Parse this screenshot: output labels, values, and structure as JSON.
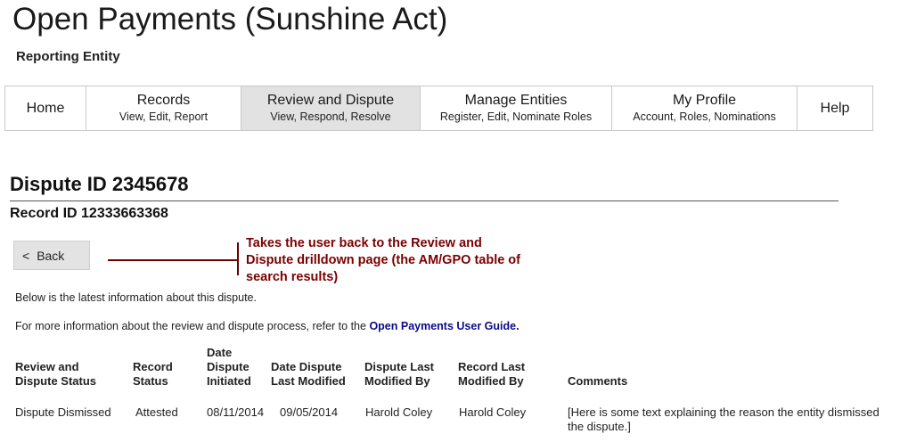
{
  "header": {
    "app_title": "Open Payments (Sunshine Act)",
    "subtitle": "Reporting Entity"
  },
  "nav": {
    "items": [
      {
        "label": "Home",
        "sub": ""
      },
      {
        "label": "Records",
        "sub": "View, Edit, Report"
      },
      {
        "label": "Review and Dispute",
        "sub": "View, Respond, Resolve"
      },
      {
        "label": "Manage Entities",
        "sub": "Register, Edit, Nominate Roles"
      },
      {
        "label": "My Profile",
        "sub": "Account, Roles, Nominations"
      },
      {
        "label": "Help",
        "sub": ""
      }
    ],
    "active_index": 2
  },
  "page": {
    "dispute_id": "Dispute ID 2345678",
    "record_id": "Record ID 12333663368"
  },
  "back_button": {
    "chevron": "<",
    "label": "Back"
  },
  "annotation": {
    "text": "Takes the user back to the Review and Dispute drilldown page (the AM/GPO table of search results)",
    "color": "#7a0000"
  },
  "info": {
    "line1": "Below is the latest information about this dispute.",
    "line2_prefix": "For more information about the review and dispute process, refer to the ",
    "guide_link": "Open Payments User Guide."
  },
  "table": {
    "headers": [
      [
        "Review and",
        "Dispute Status"
      ],
      [
        "Record",
        "Status"
      ],
      [
        "Date",
        "Dispute",
        "Initiated"
      ],
      [
        "Date Dispute",
        "Last Modified"
      ],
      [
        "Dispute Last",
        "Modified By"
      ],
      [
        "Record Last",
        "Modified By"
      ],
      [
        "Comments"
      ]
    ],
    "rows": [
      {
        "review_status": "Dispute Dismissed",
        "record_status": "Attested",
        "date_initiated": "08/11/2014",
        "date_last_modified": "09/05/2014",
        "dispute_modified_by": "Harold Coley",
        "record_modified_by": "Harold Coley",
        "comments": "[Here is some text explaining the reason the entity dismissed the dispute.]"
      }
    ]
  }
}
